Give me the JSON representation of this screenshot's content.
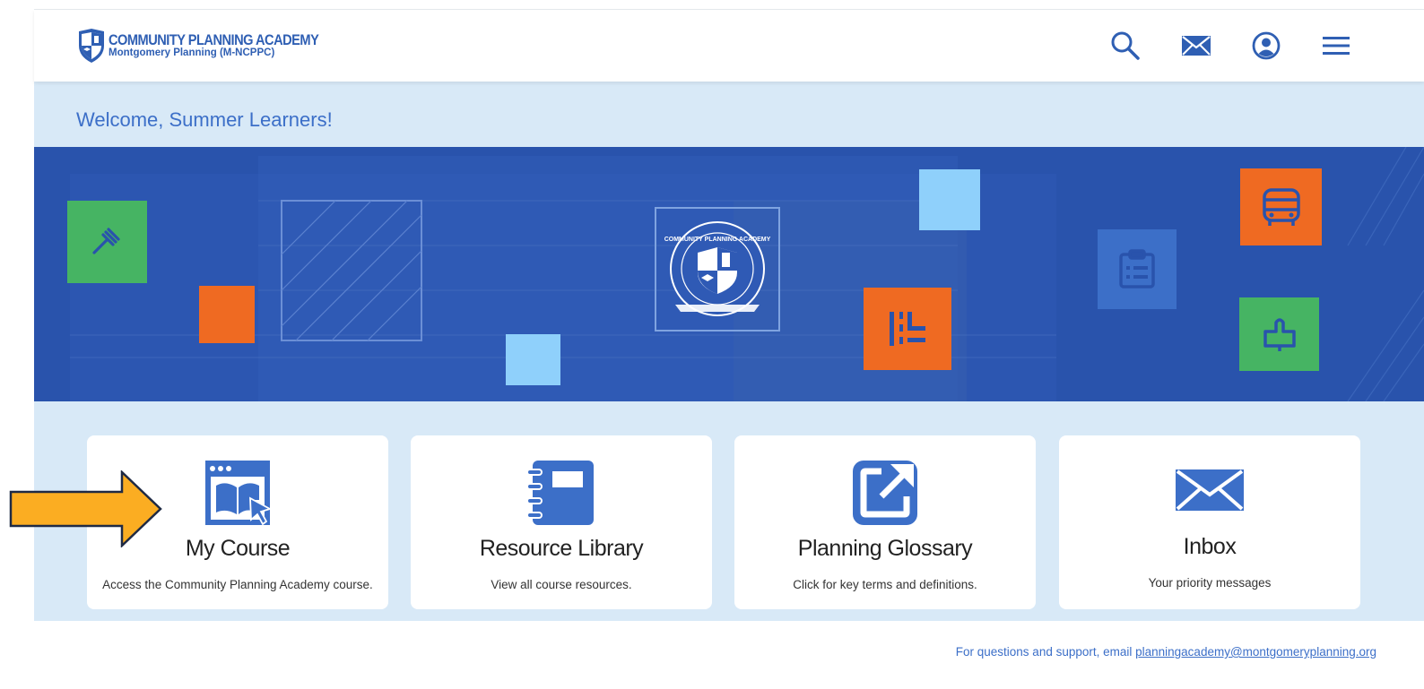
{
  "header": {
    "logo_title": "COMMUNITY PLANNING ACADEMY",
    "logo_subtitle": "Montgomery Planning  (M-NCPPC)",
    "icons": [
      "search-icon",
      "mail-icon",
      "account-icon",
      "menu-icon"
    ]
  },
  "welcome": "Welcome, Summer Learners!",
  "cards": [
    {
      "title": "My Course",
      "description": "Access the Community Planning Academy course.",
      "icon": "course-icon"
    },
    {
      "title": "Resource Library",
      "description": "View all course resources.",
      "icon": "notebook-icon"
    },
    {
      "title": "Planning Glossary",
      "description": "Click for key terms and definitions.",
      "icon": "external-link-icon"
    },
    {
      "title": "Inbox",
      "description": "Your priority messages",
      "icon": "envelope-icon"
    }
  ],
  "footer": {
    "text": "For questions and support, email ",
    "email": "planningacademy@montgomeryplanning.org"
  },
  "colors": {
    "brand_blue": "#3c6fc8",
    "hero_blue": "#2953ac",
    "band": "#d8e9f7",
    "green": "#46b463",
    "orange": "#ef6a22",
    "light_blue": "#8fd0fb",
    "arrow": "#fbad22"
  }
}
